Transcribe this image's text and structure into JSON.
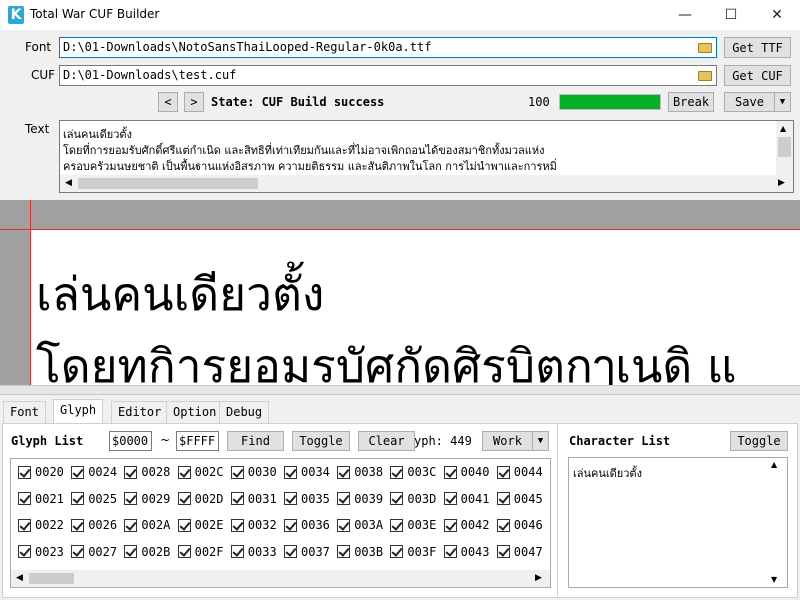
{
  "window": {
    "title": "Total War CUF Builder",
    "icon_letter": "K",
    "minimize": "—",
    "maximize": "☐",
    "close": "✕"
  },
  "font_row": {
    "label": "Font",
    "path": "D:\\01-Downloads\\NotoSansThaiLooped-Regular-0k0a.ttf",
    "button": "Get TTF"
  },
  "cuf_row": {
    "label": "CUF",
    "path": "D:\\01-Downloads\\test.cuf",
    "button": "Get CUF"
  },
  "state_row": {
    "prev": "<",
    "next": ">",
    "state_text": "State: CUF Build success",
    "progress_value": "100",
    "progress_fraction": 1.0,
    "progress_color": "#06b025",
    "break_button": "Break",
    "save_button": "Save",
    "save_dropdown": "▼"
  },
  "text_section": {
    "label": "Text",
    "lines": [
      "เล่นคนเดียวตั้ง",
      "โดยที่การยอมรับศักดิ์ศรีแต่กำเนิด และสิทธิที่เท่าเทียมกันและที่ไม่อาจเพิกถอนได้ของสมาชิกทั้งมวลแห่ง",
      "ครอบครัวมนุษยชาติ เป็นพื้นฐานแห่งอิสรภาพ ความยุติธรรม และสันติภาพในโลก การไม่นำพาและการหมิ่"
    ]
  },
  "preview": {
    "line1": "เล่นคนเดียวตั้ง",
    "line2": "โดยทกิารยอมรบัศกัดศิรบิตกๅเนดิ แ"
  },
  "tabs": [
    {
      "label": "Font",
      "active": false
    },
    {
      "label": "Glyph",
      "active": true
    },
    {
      "label": "Editor",
      "active": false
    },
    {
      "label": "Option",
      "active": false
    },
    {
      "label": "Debug",
      "active": false
    }
  ],
  "glyph_panel": {
    "title": "Glyph List",
    "range_start": "$0000",
    "range_sep": "~",
    "range_end": "$FFFF",
    "find_button": "Find",
    "toggle_button": "Toggle",
    "clear_button": "Clear",
    "glyph_count": "yph: 449",
    "work_button": "Work",
    "work_dropdown": "▼",
    "columns": [
      [
        "0020",
        "0021",
        "0022",
        "0023"
      ],
      [
        "0024",
        "0025",
        "0026",
        "0027"
      ],
      [
        "0028",
        "0029",
        "002A",
        "002B"
      ],
      [
        "002C",
        "002D",
        "002E",
        "002F"
      ],
      [
        "0030",
        "0031",
        "0032",
        "0033"
      ],
      [
        "0034",
        "0035",
        "0036",
        "0037"
      ],
      [
        "0038",
        "0039",
        "003A",
        "003B"
      ],
      [
        "003C",
        "003D",
        "003E",
        "003F"
      ],
      [
        "0040",
        "0041",
        "0042",
        "0043"
      ],
      [
        "0044",
        "0045",
        "0046",
        "0047"
      ]
    ]
  },
  "char_panel": {
    "title": "Character List",
    "toggle_button": "Toggle",
    "content": "เล่นคนเดียวตั้ง"
  }
}
